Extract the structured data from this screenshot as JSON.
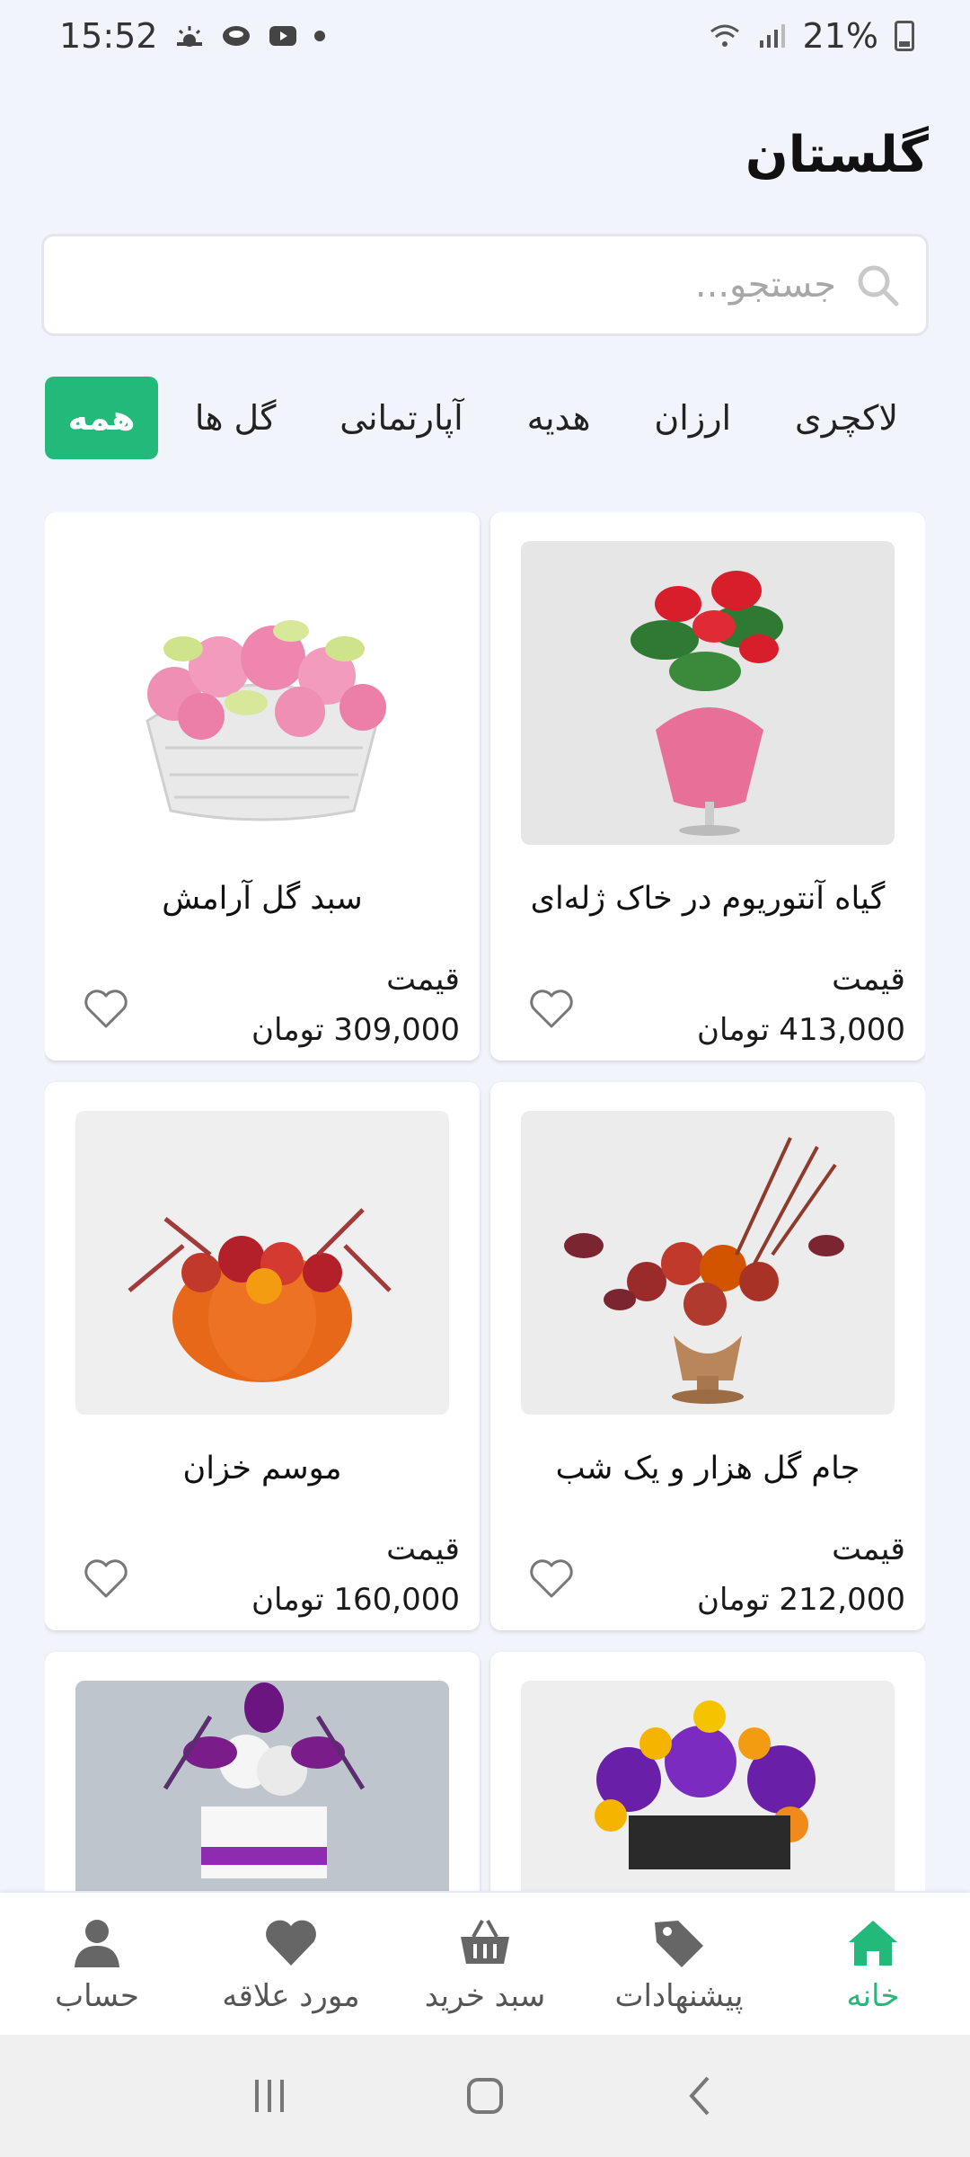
{
  "status_bar": {
    "time": "15:52",
    "battery": "21%"
  },
  "header": {
    "title": "گلستان"
  },
  "search": {
    "placeholder": "جستجو..."
  },
  "categories": [
    {
      "label": "لاکچری",
      "active": false
    },
    {
      "label": "ارزان",
      "active": false
    },
    {
      "label": "هدیه",
      "active": false
    },
    {
      "label": "آپارتمانی",
      "active": false
    },
    {
      "label": "گل ها",
      "active": false
    },
    {
      "label": "همه",
      "active": true
    }
  ],
  "products": [
    {
      "name": "گیاه آنتوریوم در خاک ژله‌ای",
      "price_label": "قیمت",
      "price": "413,000 تومان"
    },
    {
      "name": "سبد گل آرامش",
      "price_label": "قیمت",
      "price": "309,000 تومان"
    },
    {
      "name": "جام گل هزار و یک شب",
      "price_label": "قیمت",
      "price": "212,000 تومان"
    },
    {
      "name": "موسم خزان",
      "price_label": "قیمت",
      "price": "160,000 تومان"
    },
    {
      "name": "",
      "price_label": "",
      "price": ""
    },
    {
      "name": "",
      "price_label": "",
      "price": ""
    }
  ],
  "bottom_nav": [
    {
      "label": "خانه",
      "icon": "home-icon",
      "active": true
    },
    {
      "label": "پیشنهادات",
      "icon": "tag-icon",
      "active": false
    },
    {
      "label": "سبد خرید",
      "icon": "basket-icon",
      "active": false
    },
    {
      "label": "مورد علاقه",
      "icon": "heart-icon",
      "active": false
    },
    {
      "label": "حساب",
      "icon": "user-icon",
      "active": false
    }
  ],
  "colors": {
    "accent": "#23b97a",
    "background": "#f1f4fb"
  }
}
